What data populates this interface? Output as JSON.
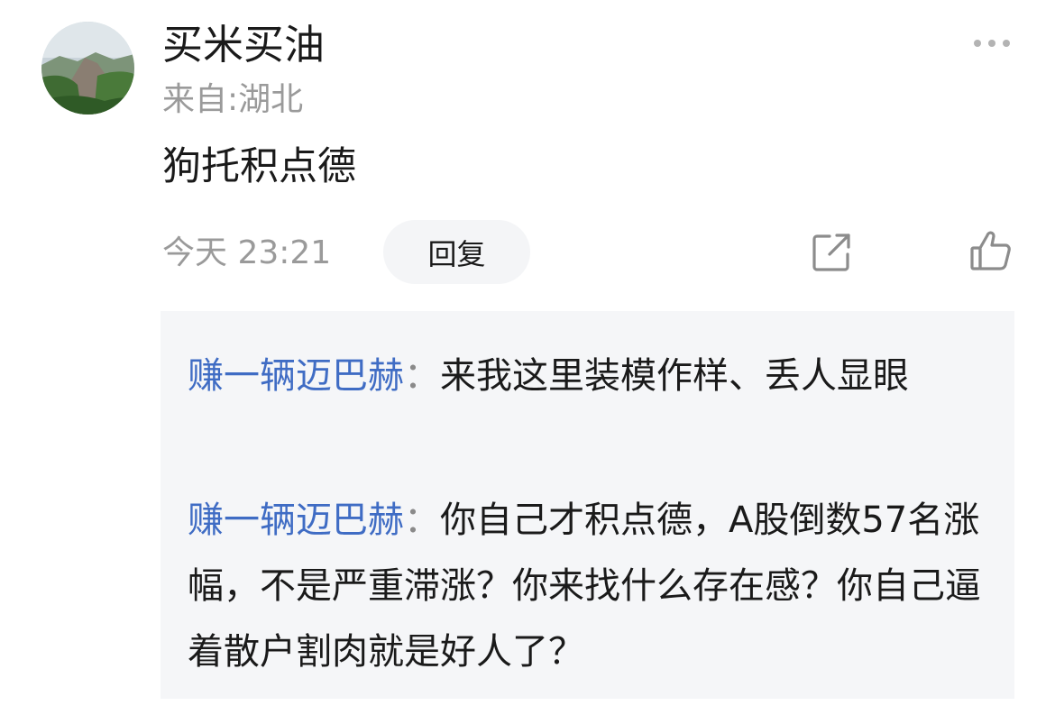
{
  "comment": {
    "username": "买米买油",
    "location": "来自:湖北",
    "text": "狗托积点德",
    "timestamp": "今天 23:21",
    "reply_label": "回复"
  },
  "icons": {
    "more": "more-dots-icon",
    "share": "share-icon",
    "like": "thumbs-up-icon"
  },
  "replies": [
    {
      "author": "赚一辆迈巴赫",
      "separator": "：",
      "text": "来我这里装模作样、丢人显眼"
    },
    {
      "author": "赚一辆迈巴赫",
      "separator": "：",
      "text": "你自己才积点德，A股倒数57名涨幅，不是严重滞涨？你来找什么存在感？你自己逼着散户割肉就是好人了？"
    }
  ],
  "colors": {
    "author_link": "#3f6cc4",
    "secondary_text": "#9a9a9a",
    "reply_box_bg": "#f5f6f8"
  }
}
